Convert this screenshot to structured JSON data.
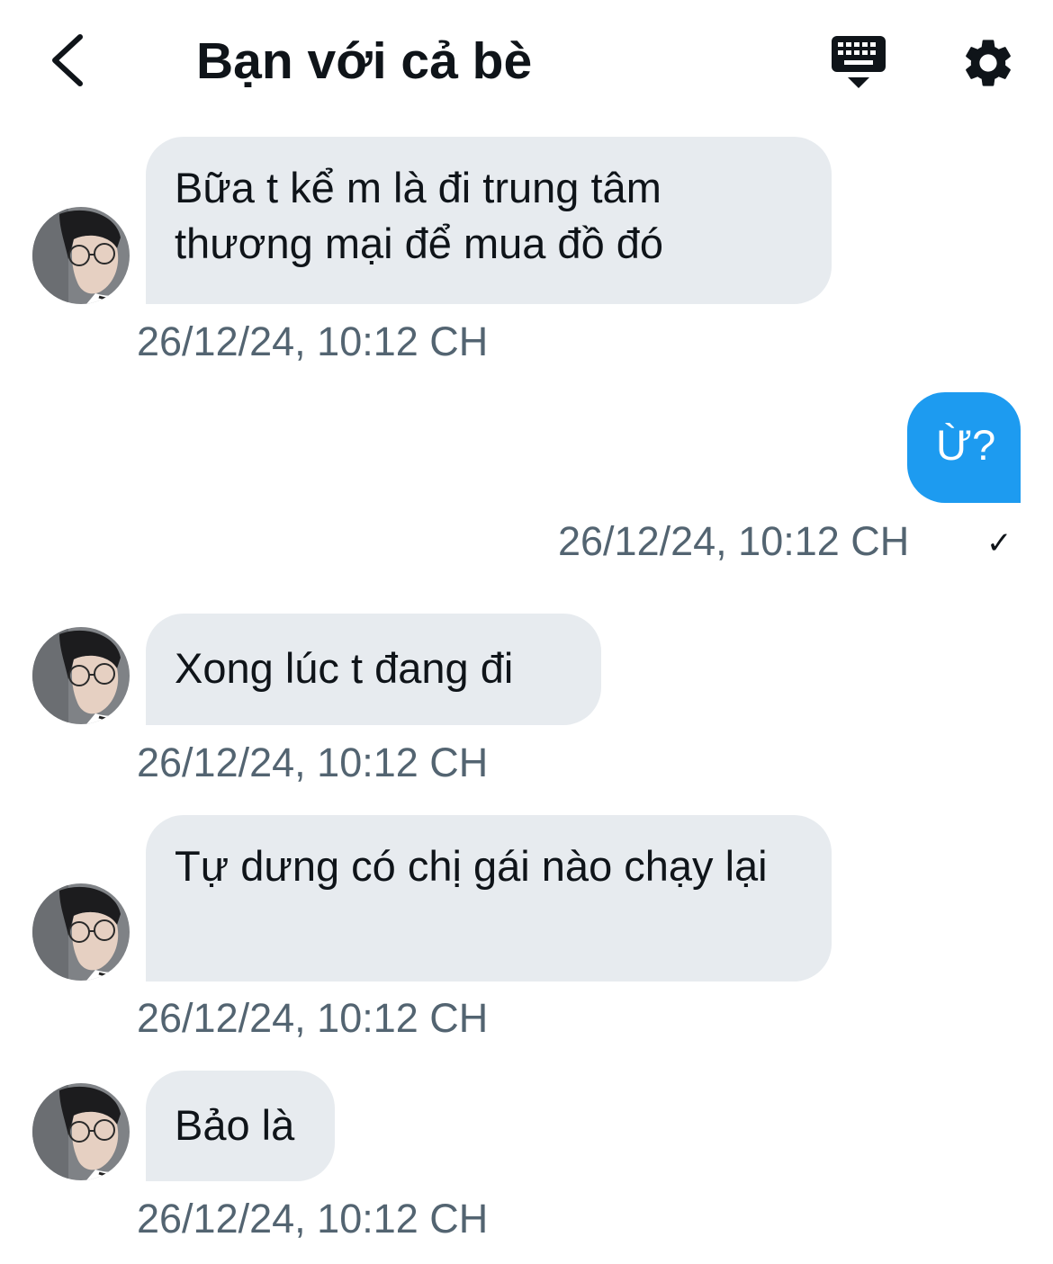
{
  "header": {
    "title": "Bạn với cả bè",
    "back_icon": "chevron-left-icon",
    "keyboard_icon": "keyboard-hide-icon",
    "settings_icon": "gear-icon"
  },
  "colors": {
    "incoming_bubble": "#e7ebef",
    "outgoing_bubble": "#1d9bf0",
    "timestamp": "#536471",
    "text": "#0f1419"
  },
  "messages": [
    {
      "direction": "in",
      "text": "Bữa t kể m là đi trung tâm thương mại để mua đồ đó",
      "timestamp": "26/12/24, 10:12 CH"
    },
    {
      "direction": "out",
      "text": "Ừ?",
      "timestamp": "26/12/24, 10:12 CH",
      "status_icon": "check-icon"
    },
    {
      "direction": "in",
      "text": "Xong lúc t đang đi",
      "timestamp": "26/12/24, 10:12 CH"
    },
    {
      "direction": "in",
      "text": "Tự dưng có chị gái nào chạy lại",
      "timestamp": "26/12/24, 10:12 CH"
    },
    {
      "direction": "in",
      "text": "Bảo là",
      "timestamp": "26/12/24, 10:12 CH"
    }
  ]
}
